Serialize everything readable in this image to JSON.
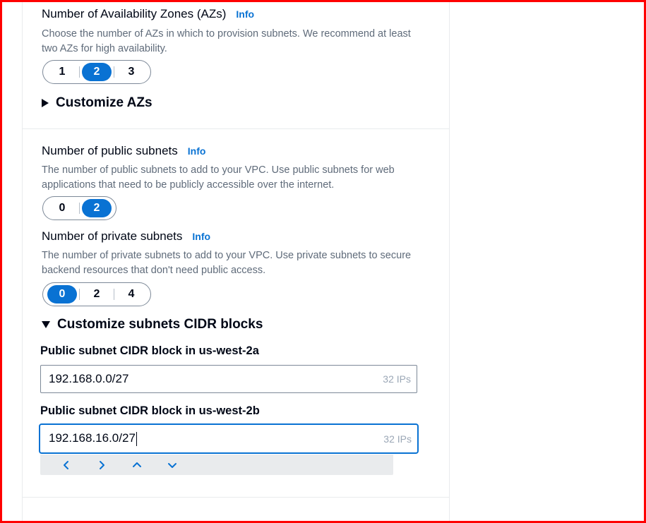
{
  "availability_zones": {
    "label": "Number of Availability Zones (AZs)",
    "info": "Info",
    "description": "Choose the number of AZs in which to provision subnets. We recommend at least two AZs for high availability.",
    "options": [
      "1",
      "2",
      "3"
    ],
    "selected": "2"
  },
  "customize_azs": {
    "label": "Customize AZs",
    "expanded": false
  },
  "public_subnets": {
    "label": "Number of public subnets",
    "info": "Info",
    "description": "The number of public subnets to add to your VPC. Use public subnets for web applications that need to be publicly accessible over the internet.",
    "options": [
      "0",
      "2"
    ],
    "selected": "2"
  },
  "private_subnets": {
    "label": "Number of private subnets",
    "info": "Info",
    "description": "The number of private subnets to add to your VPC. Use private subnets to secure backend resources that don't need public access.",
    "options": [
      "0",
      "2",
      "4"
    ],
    "selected": "0"
  },
  "customize_cidr": {
    "label": "Customize subnets CIDR blocks",
    "expanded": true
  },
  "cidr_fields": [
    {
      "label": "Public subnet CIDR block in us-west-2a",
      "value": "192.168.0.0/27",
      "suffix": "32 IPs"
    },
    {
      "label": "Public subnet CIDR block in us-west-2b",
      "value": "192.168.16.0/27",
      "suffix": "32 IPs"
    }
  ],
  "nav_icons": [
    "chevron-left-icon",
    "chevron-right-icon",
    "chevron-up-icon",
    "chevron-down-icon"
  ],
  "colors": {
    "accent": "#0972d3",
    "frame": "#ff0000",
    "text": "#000716",
    "muted": "#5f6b7a"
  }
}
